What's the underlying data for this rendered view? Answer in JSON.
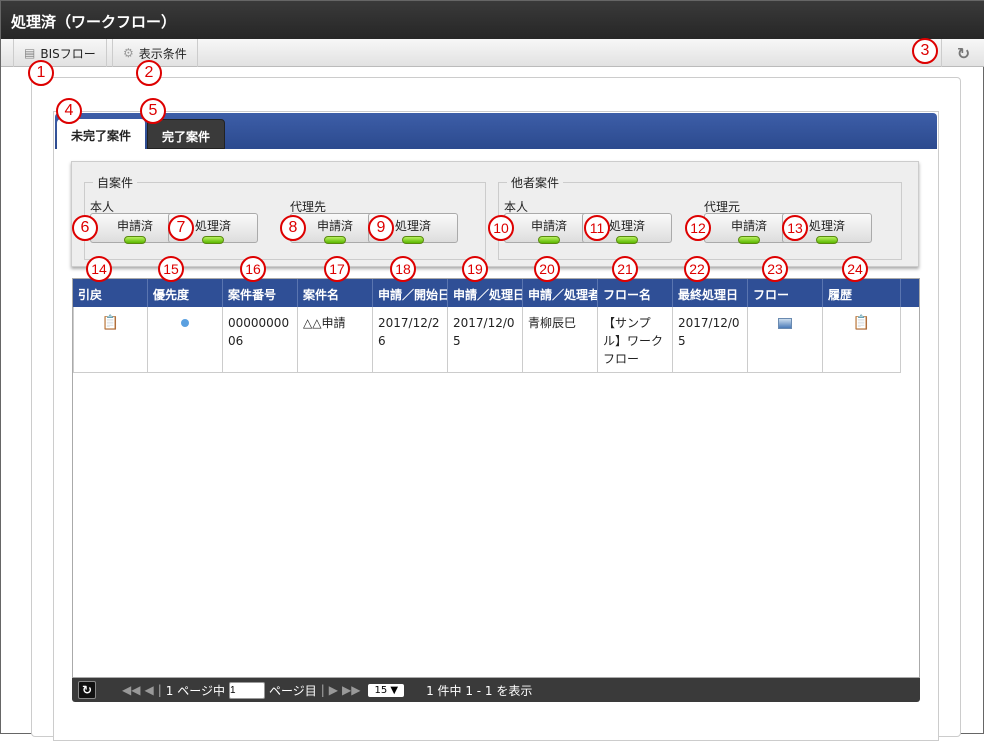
{
  "title": "処理済（ワークフロー）",
  "toolbar": {
    "bis_flow": "BISフロー",
    "display_conditions": "表示条件",
    "refresh_icon": "refresh-icon"
  },
  "tabs": [
    {
      "label": "未完了案件",
      "active": true
    },
    {
      "label": "完了案件",
      "active": false
    }
  ],
  "filter": {
    "own": {
      "legend": "自案件",
      "self_label": "本人",
      "proxy_label": "代理先"
    },
    "others": {
      "legend": "他者案件",
      "self_label": "本人",
      "proxy_label": "代理元"
    },
    "buttons": [
      "申請済",
      "処理済",
      "申請済",
      "処理済",
      "申請済",
      "処理済",
      "申請済",
      "処理済"
    ]
  },
  "table": {
    "headers": [
      "引戻",
      "優先度",
      "案件番号",
      "案件名",
      "申請／開始日",
      "申請／処理日",
      "申請／処理者",
      "フロー名",
      "最終処理日",
      "フロー",
      "履歴"
    ],
    "rows": [
      {
        "case_no": "0000000006",
        "case_name": "△△申請",
        "start_date": "2017/12/26",
        "process_date": "2017/12/05",
        "processor": "青柳辰巳",
        "flow_name": "【サンプル】ワークフロー",
        "last_date": "2017/12/05"
      }
    ]
  },
  "pager": {
    "page_of": "1 ページ中",
    "page_input": "1",
    "page_suffix": "ページ目",
    "per_page": "15 ▼",
    "summary": "1 件中 1 - 1 を表示"
  },
  "annotations": [
    "1",
    "2",
    "3",
    "4",
    "5",
    "6",
    "7",
    "8",
    "9",
    "10",
    "11",
    "12",
    "13",
    "14",
    "15",
    "16",
    "17",
    "18",
    "19",
    "20",
    "21",
    "22",
    "23",
    "24"
  ],
  "colors": {
    "header_blue": "#2f4f96",
    "title_bar": "#2b2b2b",
    "annotation_red": "#dd0000",
    "led_green": "#7ad600"
  }
}
